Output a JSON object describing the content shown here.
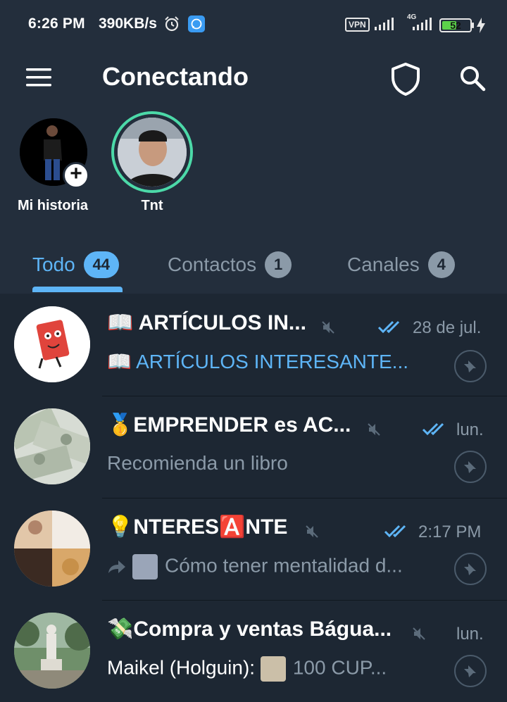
{
  "status_bar": {
    "time": "6:26 PM",
    "speed": "390KB/s",
    "vpn": "VPN",
    "network": "4G",
    "battery": "52",
    "battery_level": 0.52
  },
  "app_bar": {
    "title": "Conectando",
    "icons": [
      "menu-icon",
      "shield-icon",
      "search-icon"
    ]
  },
  "stories": [
    {
      "name": "Mi historia",
      "badge": "+"
    },
    {
      "name": "Tnt"
    }
  ],
  "tabs": [
    {
      "label": "Todo",
      "count": "44",
      "active": true
    },
    {
      "label": "Contactos",
      "count": "1"
    },
    {
      "label": "Canales",
      "count": "4"
    }
  ],
  "chats": [
    {
      "emoji": "📖",
      "title": "ARTÍCULOS IN...",
      "time": "28 de jul.",
      "preview_emoji": "📖",
      "preview": "ARTÍCULOS INTERESANTE...",
      "preview_style": "blue",
      "muted": true,
      "read": true,
      "pinned": true
    },
    {
      "emoji": "🥇",
      "title": "EMPRENDER es AC...",
      "time": "lun.",
      "preview": "Recomienda un libro",
      "muted": true,
      "read": true,
      "pinned": true
    },
    {
      "emoji": "💡",
      "title_a": "NTERES",
      "title_badge": "🅰️",
      "title_b": "NTE",
      "time": "2:17 PM",
      "preview": "Cómo tener mentalidad d...",
      "forwarded": true,
      "muted": true,
      "read": true,
      "pinned": true
    },
    {
      "emoji": "💸",
      "title": "Compra y ventas Bágua...",
      "time": "lun.",
      "sender": "Maikel (Holguin):",
      "preview": "100 CUP...",
      "muted": true,
      "pinned": true
    }
  ],
  "colors": {
    "background": "#1d2733",
    "header": "#232e3c",
    "accent": "#5eb5f7",
    "muted_text": "#8b9aa8"
  }
}
